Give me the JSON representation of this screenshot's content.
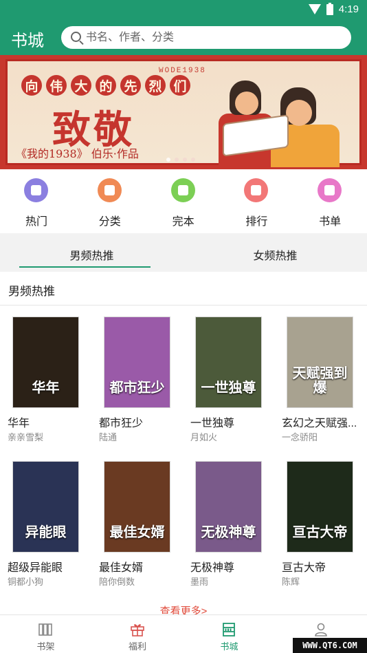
{
  "status_bar": {
    "time": "4:19"
  },
  "header": {
    "title": "书城",
    "search_placeholder": "书名、作者、分类"
  },
  "banner": {
    "top_text": "WODE1938",
    "headline_chars": [
      "向",
      "伟",
      "大",
      "的",
      "先",
      "烈",
      "们"
    ],
    "main_text": "致敬",
    "subtitle": "《我的1938》 伯乐·作品",
    "slide_count": 4,
    "active_slide": 0
  },
  "categories": [
    {
      "label": "热门",
      "icon": "crown-icon",
      "color": "#8b7fe0"
    },
    {
      "label": "分类",
      "icon": "grid-icon",
      "color": "#f08a55"
    },
    {
      "label": "完本",
      "icon": "book-icon",
      "color": "#7ccf55"
    },
    {
      "label": "排行",
      "icon": "trophy-icon",
      "color": "#f27777"
    },
    {
      "label": "书单",
      "icon": "list-icon",
      "color": "#e878c8"
    }
  ],
  "tabs": [
    {
      "label": "男频热推",
      "active": true
    },
    {
      "label": "女频热推",
      "active": false
    }
  ],
  "section": {
    "title": "男频热推",
    "more_label": "查看更多>",
    "books": [
      {
        "title": "华年",
        "author": "亲亲雪梨",
        "cover_text": "华年",
        "cover_color": "#2b2117"
      },
      {
        "title": "都市狂少",
        "author": "陆通",
        "cover_text": "都市狂少",
        "cover_color": "#9a5aa8"
      },
      {
        "title": "一世独尊",
        "author": "月如火",
        "cover_text": "一世独尊",
        "cover_color": "#4c5a3a"
      },
      {
        "title": "玄幻之天赋强...",
        "author": "一念骄阳",
        "cover_text": "天赋强到爆",
        "cover_color": "#a8a290"
      },
      {
        "title": "超级异能眼",
        "author": "铜都小狗",
        "cover_text": "异能眼",
        "cover_color": "#2a3355"
      },
      {
        "title": "最佳女婿",
        "author": "陪你倒数",
        "cover_text": "最佳女婿",
        "cover_color": "#6a3a22"
      },
      {
        "title": "无极神尊",
        "author": "墨雨",
        "cover_text": "无极神尊",
        "cover_color": "#7a5a8a"
      },
      {
        "title": "亘古大帝",
        "author": "陈辉",
        "cover_text": "亘古大帝",
        "cover_color": "#1e2a1a"
      }
    ]
  },
  "bottom_nav": [
    {
      "label": "书架",
      "icon": "bookshelf-icon",
      "active": false
    },
    {
      "label": "福利",
      "icon": "gift-icon",
      "active": false
    },
    {
      "label": "书城",
      "icon": "bookstore-icon",
      "active": true
    },
    {
      "label": "",
      "icon": "profile-icon",
      "active": false
    }
  ],
  "watermark": "WWW.QT6.COM",
  "colors": {
    "accent": "#1f9a70",
    "more_link": "#e04a3a"
  }
}
